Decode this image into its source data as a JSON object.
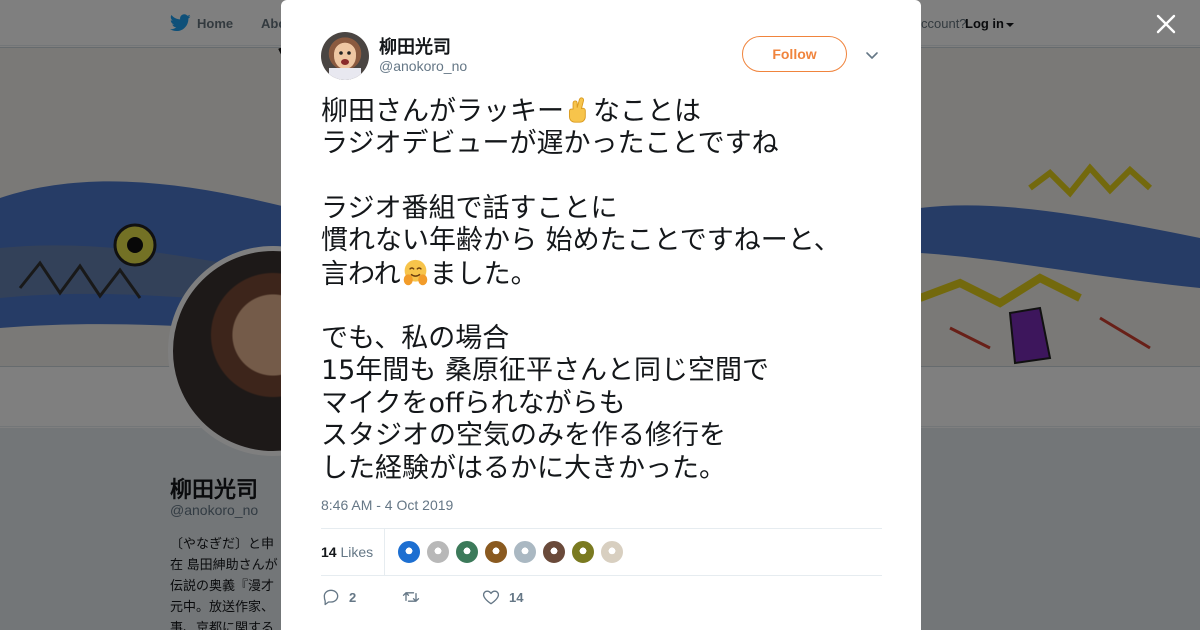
{
  "background": {
    "nav": {
      "home_label": "Home",
      "about_label": "Abo",
      "account_text": "ccount?",
      "login_label": "Log in"
    },
    "profile": {
      "name": "柳田光司",
      "handle": "@anokoro_no",
      "bio_lines": [
        "〔やなぎだ〕と申",
        "在 島田紳助さんが",
        "伝説の奥義『漫才",
        "元中。放送作家、",
        "事、京都に関する"
      ]
    }
  },
  "tweet": {
    "author_name": "柳田光司",
    "author_handle": "@anokoro_no",
    "follow_label": "Follow",
    "lines": [
      [
        "柳田さんがラッキー",
        "[crossed-fingers]",
        "なことは"
      ],
      [
        "ラジオデビューが遅かったことですね"
      ],
      [
        ""
      ],
      [
        "ラジオ番組で話すことに"
      ],
      [
        "慣れない年齢から 始めたことですねーと、"
      ],
      [
        "言われ",
        "[hugging-face]",
        "ました。"
      ],
      [
        ""
      ],
      [
        "でも、私の場合"
      ],
      [
        "15年間も 桑原征平さんと同じ空間で"
      ],
      [
        "マイクをoffられながらも"
      ],
      [
        "スタジオの空気のみを作る修行を"
      ],
      [
        "した経験がはるかに大きかった。"
      ]
    ],
    "timestamp": "8:46 AM - 4 Oct 2019",
    "likes_count": "14",
    "likes_label": "Likes",
    "likers": [
      {
        "name": "liker-1",
        "color": "#1d6fd1"
      },
      {
        "name": "liker-2",
        "color": "#b8b8b8"
      },
      {
        "name": "liker-3",
        "color": "#3c7a5a"
      },
      {
        "name": "liker-4",
        "color": "#8a5a20"
      },
      {
        "name": "liker-5",
        "color": "#aab8c2"
      },
      {
        "name": "liker-6",
        "color": "#6a4a3a"
      },
      {
        "name": "liker-7",
        "color": "#7a7a20"
      },
      {
        "name": "liker-8",
        "color": "#d8cfc0"
      }
    ],
    "actions": {
      "reply_count": "2",
      "retweet_count": "",
      "like_count": "14"
    }
  },
  "colors": {
    "accent": "#f0843d",
    "twitter_blue": "#1da1f2",
    "text": "#14171a",
    "muted": "#657786"
  },
  "icons": [
    "twitter-bird-icon",
    "close-icon",
    "chevron-down-icon",
    "reply-icon",
    "retweet-icon",
    "heart-icon",
    "crossed-fingers-emoji",
    "hugging-face-emoji"
  ]
}
